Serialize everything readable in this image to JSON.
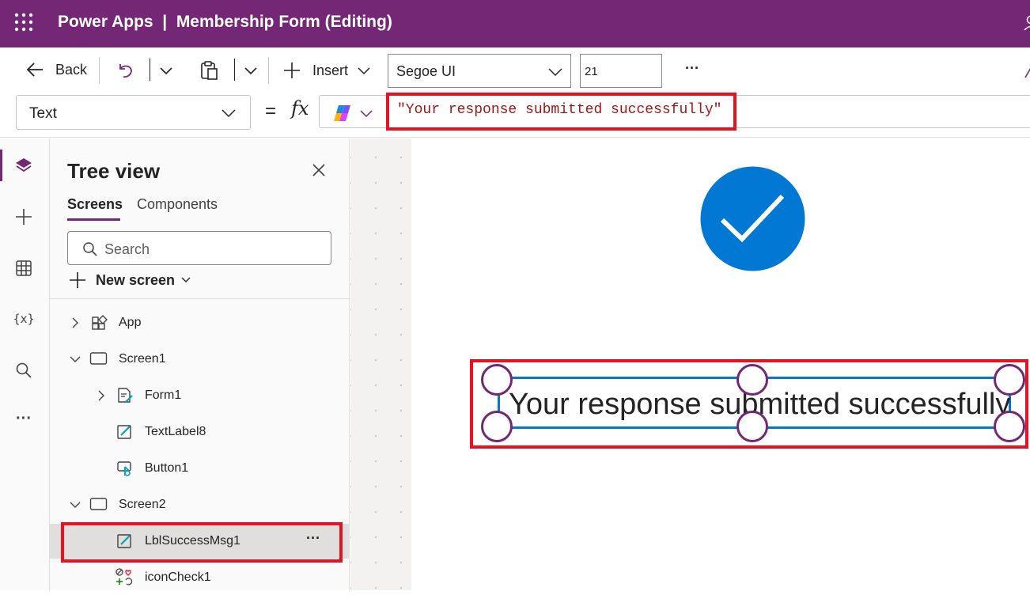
{
  "app": {
    "product": "Power Apps",
    "separator": "|",
    "document_title": "Membership Form (Editing)"
  },
  "toolbar": {
    "back_label": "Back",
    "insert_label": "Insert",
    "font_family": "Segoe UI",
    "font_size": "21",
    "more_label": "···"
  },
  "formula_bar": {
    "property": "Text",
    "equals": "=",
    "fx": "fx",
    "formula": "\"Your response submitted successfully\""
  },
  "tree_view": {
    "title": "Tree view",
    "tabs": [
      {
        "label": "Screens",
        "active": true
      },
      {
        "label": "Components",
        "active": false
      }
    ],
    "search_placeholder": "Search",
    "new_screen_label": "New screen",
    "items": [
      {
        "label": "App",
        "icon": "app-icon",
        "expander": "collapsed"
      },
      {
        "label": "Screen1",
        "icon": "screen-icon",
        "expander": "expanded"
      },
      {
        "label": "Form1",
        "icon": "form-icon",
        "expander": "collapsed"
      },
      {
        "label": "TextLabel8",
        "icon": "label-icon",
        "expander": "none"
      },
      {
        "label": "Button1",
        "icon": "button-icon",
        "expander": "none"
      },
      {
        "label": "Screen2",
        "icon": "screen-icon",
        "expander": "expanded"
      },
      {
        "label": "LblSuccessMsg1",
        "icon": "label-icon",
        "expander": "none",
        "selected": true,
        "more": "···"
      },
      {
        "label": "iconCheck1",
        "icon": "icon-control-icon",
        "expander": "none"
      }
    ]
  },
  "canvas": {
    "label_text": "Your response submitted successfully",
    "check_icon": "checkmark-circle-icon"
  },
  "colors": {
    "brand": "#742774",
    "accent_blue": "#0078d4",
    "highlight_red": "#e81123"
  }
}
